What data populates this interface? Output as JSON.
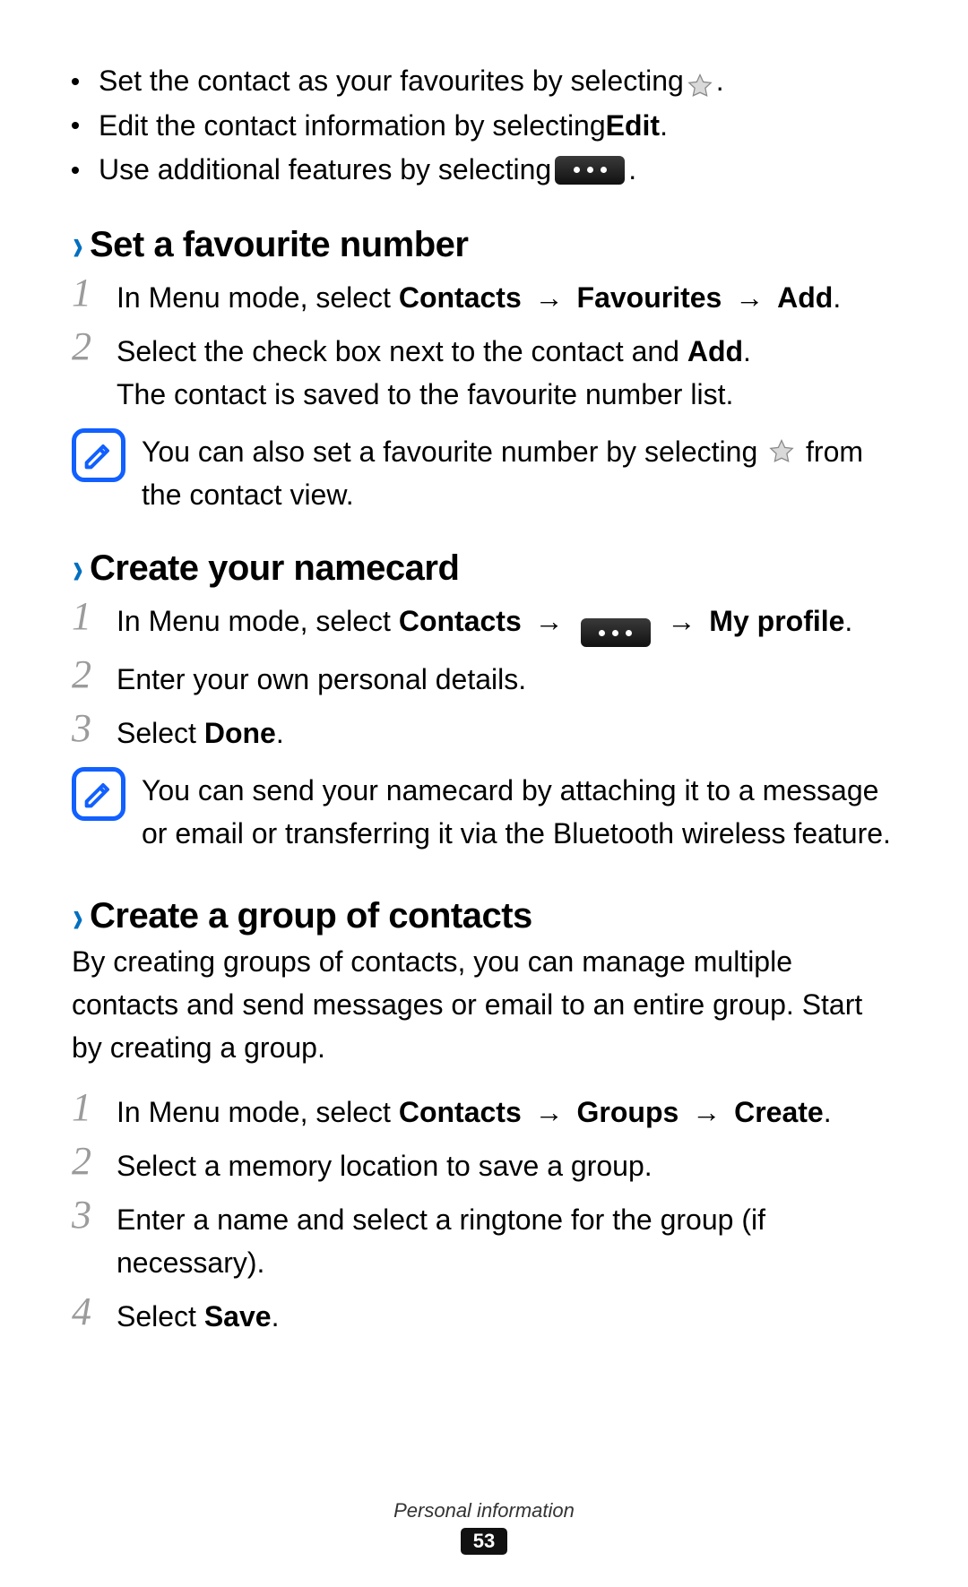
{
  "bullets": {
    "b1a": "Set the contact as your favourites by selecting ",
    "b1b": ".",
    "b2a": "Edit the contact information by selecting ",
    "b2_bold": "Edit",
    "b2b": ".",
    "b3a": "Use additional features by selecting ",
    "b3b": "."
  },
  "section1": {
    "title": "Set a favourite number",
    "step1": {
      "a": "In Menu mode, select ",
      "contacts": "Contacts",
      "arrow1": " → ",
      "favourites": "Favourites",
      "arrow2": " → ",
      "add": "Add",
      "b": "."
    },
    "step2": {
      "a": "Select the check box next to the contact and ",
      "add": "Add",
      "b": ".",
      "line2": "The contact is saved to the favourite number list."
    },
    "note": {
      "a": "You can also set a favourite number by selecting ",
      "b": " from the contact view."
    }
  },
  "section2": {
    "title": "Create your namecard",
    "step1": {
      "a": "In Menu mode, select ",
      "contacts": "Contacts",
      "arrow1": " → ",
      "arrow2": " → ",
      "myprofile": "My profile",
      "b": "."
    },
    "step2": "Enter your own personal details.",
    "step3": {
      "a": "Select ",
      "done": "Done",
      "b": "."
    },
    "note": "You can send your namecard by attaching it to a message or email or transferring it via the Bluetooth wireless feature."
  },
  "section3": {
    "title": "Create a group of contacts",
    "intro": "By creating groups of contacts, you can manage multiple contacts and send messages or email to an entire group. Start by creating a group.",
    "step1": {
      "a": "In Menu mode, select ",
      "contacts": "Contacts",
      "arrow1": " → ",
      "groups": "Groups",
      "arrow2": " → ",
      "create": "Create",
      "b": "."
    },
    "step2": "Select a memory location to save a group.",
    "step3": "Enter a name and select a ringtone for the group (if necessary).",
    "step4": {
      "a": "Select ",
      "save": "Save",
      "b": "."
    }
  },
  "footer": {
    "section": "Personal information",
    "page": "53"
  },
  "nums": {
    "n1": "1",
    "n2": "2",
    "n3": "3",
    "n4": "4"
  }
}
